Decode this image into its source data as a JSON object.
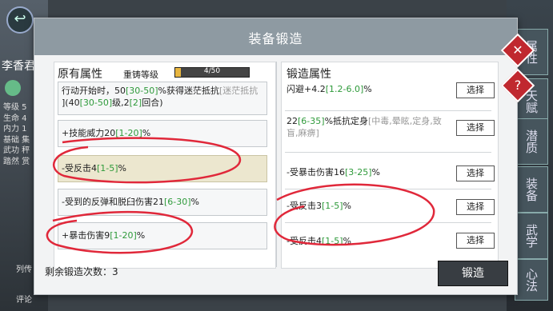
{
  "dialog": {
    "title": "装备锻造"
  },
  "original": {
    "section_label": "原有属性",
    "reforge_label": "重铸等级",
    "reforge_progress_text": "4/50",
    "reforge_fraction": 0.08,
    "slots": [
      {
        "l1a": "行动开始时，50",
        "l1g": "[30-50]",
        "l1b": "%获得迷茫抵抗",
        "l1gr": "[迷茫抵抗",
        "l2a": "](40",
        "l2g": "[30-50]",
        "l2b": "级,2",
        "l2g2": "[2]",
        "l2c": "回合)"
      },
      {
        "a": "+技能威力20",
        "g": "[1-20]",
        "b": "%"
      },
      {
        "a": "-受反击4",
        "g": "[1-5]",
        "b": "%"
      },
      {
        "a": "-受到的反弹和脱臼伤害21",
        "g": "[6-30]",
        "b": "%"
      },
      {
        "a": "+暴击伤害9",
        "g": "[1-20]",
        "b": "%"
      }
    ]
  },
  "forge": {
    "section_label": "锻造属性",
    "choose_label": "选择",
    "slots": [
      {
        "a": "闪避+4.2",
        "g": "[1.2-6.0]",
        "b": "%"
      },
      {
        "l1a": "22",
        "l1g": "[6-35]",
        "l1b": "%抵抗定身",
        "l1gr": "[中毒,晕眩,定身,致",
        "l2gr": "盲,麻痹]"
      },
      {
        "a": "-受暴击伤害16",
        "g": "[3-25]",
        "b": "%"
      },
      {
        "a": "-受反击3",
        "g": "[1-5]",
        "b": "%"
      },
      {
        "a": "-受反击4",
        "g": "[1-5]",
        "b": "%"
      }
    ]
  },
  "footer": {
    "remaining": "剩余锻造次数：3",
    "forge_button": "锻造"
  },
  "side_tabs": [
    "潜质",
    "装备",
    "武学",
    "心法"
  ],
  "side_tab_partial": [
    "属性",
    "天赋"
  ],
  "character": {
    "name": "李香君",
    "stats": [
      "等级 5",
      "生命 4",
      "内力 1",
      "基础 集",
      "武功 秤",
      "踏然 赏"
    ]
  },
  "bottom_tabs": [
    "列传",
    "评论"
  ],
  "colors": {
    "accent_green": "#2e9a3a",
    "annotation_red": "#e0283a",
    "header": "#8e9aa2"
  }
}
